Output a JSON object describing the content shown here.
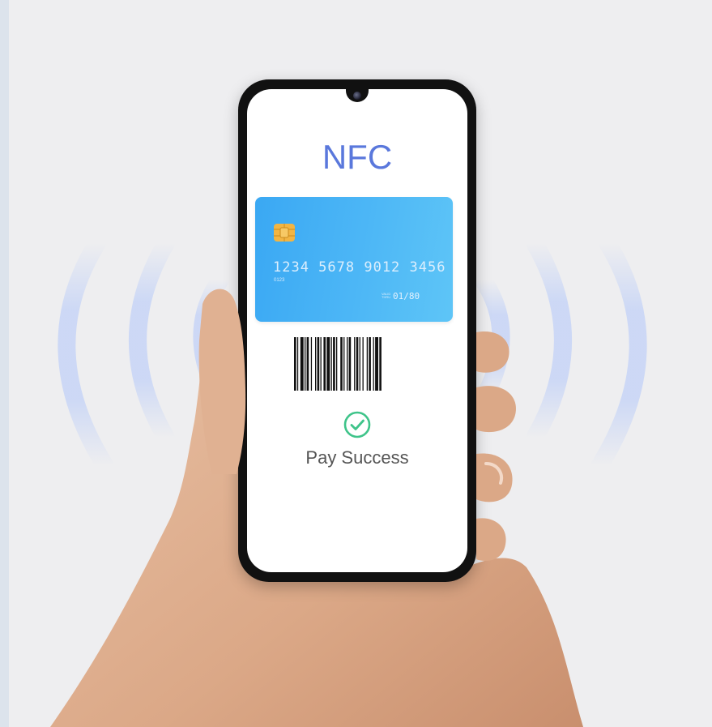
{
  "screen": {
    "title": "NFC",
    "status_text": "Pay Success",
    "status_icon": "check-circle-icon"
  },
  "card": {
    "number": "1234  5678  9012  3456",
    "sub_number": "0123",
    "valid_label": "VALID THRU",
    "expiry": "01/80",
    "chip_icon": "card-chip-icon"
  },
  "colors": {
    "accent": "#5a78dc",
    "card_blue": "#4db7f6",
    "success_green": "#3fc48a",
    "waves": "#c9d6f6"
  }
}
